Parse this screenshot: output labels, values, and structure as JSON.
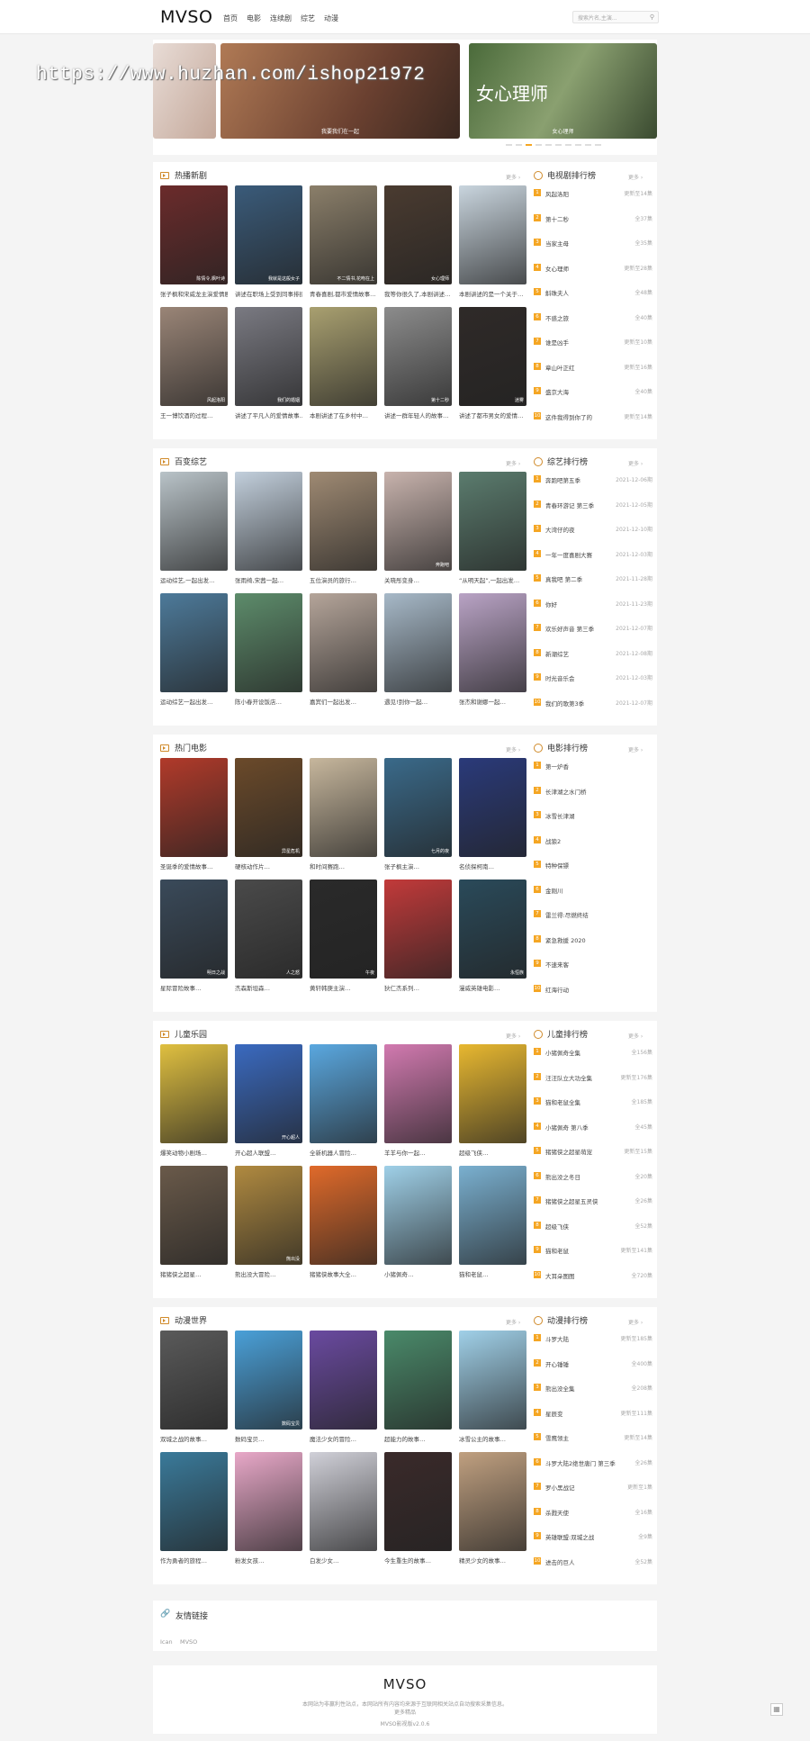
{
  "header": {
    "logo": "MVSO",
    "nav": [
      "首页",
      "电影",
      "连续剧",
      "综艺",
      "动漫"
    ],
    "search_placeholder": "搜索片名,主演..."
  },
  "watermark": "https://www.huzhan.com/ishop21972",
  "slider": {
    "slides": [
      {
        "caption": "",
        "big": "",
        "color": "#d9c8bf"
      },
      {
        "caption": "我要我们在一起",
        "big": "",
        "color": "#8a5a3c"
      },
      {
        "caption": "女心理师",
        "big": "女心理师",
        "color": "#5f7a4a"
      }
    ]
  },
  "sections": [
    {
      "title": "热播新剧",
      "more": "更多 ›",
      "items": [
        {
          "title": "张子枫和宋威龙主演爱情剧…",
          "label": "陈情令,枫叶诗",
          "color": "#6b2b2b"
        },
        {
          "title": "讲述在职场上受到同事排挤…",
          "label": "我就是这般女子",
          "color": "#3a5b7a"
        },
        {
          "title": "青春喜剧,都市爱情故事…",
          "label": "不二情书,花吻在上",
          "color": "#8b7f6a"
        },
        {
          "title": "我等你很久了,本剧讲述…",
          "label": "女心理师",
          "color": "#4a3b30"
        },
        {
          "title": "本剧讲述的是一个关于…",
          "label": "",
          "color": "#c9d5de"
        },
        {
          "title": "王一博饮酒的过程…",
          "label": "风起洛阳",
          "color": "#9a8577"
        },
        {
          "title": "讲述了平凡人的爱情故事…",
          "label": "我们的婚姻",
          "color": "#7a7a82"
        },
        {
          "title": "本剧讲述了在乡村中…",
          "label": "",
          "color": "#a9a070"
        },
        {
          "title": "讲述一群年轻人的故事…",
          "label": "第十二秒",
          "color": "#8c8c8c"
        },
        {
          "title": "讲述了都市男女的爱情…",
          "label": "迷雾",
          "color": "#2f2a28"
        }
      ],
      "rank_title": "电视剧排行榜",
      "rank": [
        {
          "name": "风起洛阳",
          "status": "更新至14集"
        },
        {
          "name": "第十二秒",
          "status": "全37集"
        },
        {
          "name": "当家主母",
          "status": "全35集"
        },
        {
          "name": "女心理师",
          "status": "更新至28集"
        },
        {
          "name": "斛珠夫人",
          "status": "全48集"
        },
        {
          "name": "不惑之旅",
          "status": "全40集"
        },
        {
          "name": "谁是凶手",
          "status": "更新至10集"
        },
        {
          "name": "章山叶正红",
          "status": "更新至16集"
        },
        {
          "name": "盛京大海",
          "status": "全40集"
        },
        {
          "name": "这件我得到你了的",
          "status": "更新至14集"
        }
      ]
    },
    {
      "title": "百变综艺",
      "more": "更多 ›",
      "items": [
        {
          "title": "运动综艺,一起出发…",
          "label": "",
          "color": "#b9c3c8"
        },
        {
          "title": "张雨绮,宋茜一起…",
          "label": "",
          "color": "#c2cfdc"
        },
        {
          "title": "五位演员的旅行…",
          "label": "",
          "color": "#9f8a73"
        },
        {
          "title": "关晓彤变身…",
          "label": "奔跑吧",
          "color": "#c8b3ad"
        },
        {
          "title": "“从明天起”,一起出发…",
          "label": "",
          "color": "#5b7c6e"
        },
        {
          "title": "运动综艺一起出发…",
          "label": "",
          "color": "#4d7a9a"
        },
        {
          "title": "陈小春开设饭店…",
          "label": "",
          "color": "#5d8c6b"
        },
        {
          "title": "嘉宾们一起出发…",
          "label": "",
          "color": "#b5a59a"
        },
        {
          "title": "遇见!到你一起…",
          "label": "",
          "color": "#a7b9c8"
        },
        {
          "title": "张杰和谢娜一起…",
          "label": "",
          "color": "#b9a3c5"
        }
      ],
      "rank_title": "综艺排行榜",
      "rank": [
        {
          "name": "奔跑吧第五季",
          "status": "2021-12-06期"
        },
        {
          "name": "青春环游记 第三季",
          "status": "2021-12-05期"
        },
        {
          "name": "大湾仔的夜",
          "status": "2021-12-10期"
        },
        {
          "name": "一年一度喜剧大赛",
          "status": "2021-12-03期"
        },
        {
          "name": "真我吧 第二季",
          "status": "2021-11-28期"
        },
        {
          "name": "你好",
          "status": "2021-11-23期"
        },
        {
          "name": "欢乐好声音 第三季",
          "status": "2021-12-07期"
        },
        {
          "name": "新潮综艺",
          "status": "2021-12-08期"
        },
        {
          "name": "时光音乐会",
          "status": "2021-12-03期"
        },
        {
          "name": "我们的歌第3季",
          "status": "2021-12-07期"
        }
      ]
    },
    {
      "title": "热门电影",
      "more": "更多 ›",
      "items": [
        {
          "title": "圣诞季的爱情故事…",
          "label": "",
          "color": "#b13a2a"
        },
        {
          "title": "硬核动作片…",
          "label": "异星危机",
          "color": "#6b4a2a"
        },
        {
          "title": "和时间赛跑…",
          "label": "",
          "color": "#c7b79d"
        },
        {
          "title": "张子枫主演…",
          "label": "七月的夜",
          "color": "#3a6a8a"
        },
        {
          "title": "名侦探柯南…",
          "label": "",
          "color": "#2a3a7a"
        },
        {
          "title": "星际冒险故事…",
          "label": "明日之战",
          "color": "#3a4a5a"
        },
        {
          "title": "杰森斯坦森…",
          "label": "人之怒",
          "color": "#4a4a4a"
        },
        {
          "title": "黄轩韩庚主演…",
          "label": "午夜",
          "color": "#2a2a2a"
        },
        {
          "title": "狄仁杰系列…",
          "label": "",
          "color": "#c23a3a"
        },
        {
          "title": "漫威英雄电影…",
          "label": "永恒族",
          "color": "#2a4a5a"
        }
      ],
      "rank_title": "电影排行榜",
      "rank": [
        {
          "name": "第一炉香",
          "status": ""
        },
        {
          "name": "长津湖之水门桥",
          "status": ""
        },
        {
          "name": "冰雪长津湖",
          "status": ""
        },
        {
          "name": "战狼2",
          "status": ""
        },
        {
          "name": "特种保镖",
          "status": ""
        },
        {
          "name": "金刚川",
          "status": ""
        },
        {
          "name": "雷兰得:尽燃终结",
          "status": ""
        },
        {
          "name": "紧急救援 2020",
          "status": ""
        },
        {
          "name": "不速来客",
          "status": ""
        },
        {
          "name": "红海行动",
          "status": ""
        }
      ]
    },
    {
      "title": "儿童乐园",
      "more": "更多 ›",
      "items": [
        {
          "title": "爆笑动物小剧场…",
          "label": "",
          "color": "#e0c040"
        },
        {
          "title": "开心超人联盟…",
          "label": "开心超人",
          "color": "#3a6ac0"
        },
        {
          "title": "全新机器人冒险…",
          "label": "",
          "color": "#5aa8e0"
        },
        {
          "title": "羊羊与你一起…",
          "label": "",
          "color": "#d27ab0"
        },
        {
          "title": "超级飞侠…",
          "label": "",
          "color": "#e8b830"
        },
        {
          "title": "猪猪侠之超星…",
          "label": "",
          "color": "#6a5a4a"
        },
        {
          "title": "熊出没大冒险…",
          "label": "熊出没",
          "color": "#b08a40"
        },
        {
          "title": "猪猪侠故事大全…",
          "label": "",
          "color": "#e06a2a"
        },
        {
          "title": "小猪佩奇…",
          "label": "",
          "color": "#9fd0e8"
        },
        {
          "title": "猫和老鼠…",
          "label": "",
          "color": "#7ab0d0"
        }
      ],
      "rank_title": "儿童排行榜",
      "rank": [
        {
          "name": "小猪佩奇全集",
          "status": "全156集"
        },
        {
          "name": "汪汪队立大功全集",
          "status": "更新至176集"
        },
        {
          "name": "猫和老鼠全集",
          "status": "全185集"
        },
        {
          "name": "小猪佩奇 第八季",
          "status": "全45集"
        },
        {
          "name": "猪猪侠之超星萌宠",
          "status": "更新至15集"
        },
        {
          "name": "熊出没之冬日",
          "status": "全20集"
        },
        {
          "name": "猪猪侠之超星五灵侠",
          "status": "全26集"
        },
        {
          "name": "超级飞侠",
          "status": "全52集"
        },
        {
          "name": "猫和老鼠",
          "status": "更新至141集"
        },
        {
          "name": "大耳朵图图",
          "status": "全720集"
        }
      ]
    },
    {
      "title": "动漫世界",
      "more": "更多 ›",
      "items": [
        {
          "title": "双城之战的故事…",
          "label": "",
          "color": "#5a5a5a"
        },
        {
          "title": "数码宝贝…",
          "label": "数码宝贝",
          "color": "#4aa0d8"
        },
        {
          "title": "魔法少女的冒险…",
          "label": "",
          "color": "#6a4aa0"
        },
        {
          "title": "超能力的故事…",
          "label": "",
          "color": "#4a8a6a"
        },
        {
          "title": "冰雪公主的故事…",
          "label": "",
          "color": "#a0d0e8"
        },
        {
          "title": "作为勇者的旅程…",
          "label": "",
          "color": "#3a7a9a"
        },
        {
          "title": "粉发女孩…",
          "label": "",
          "color": "#e8a8c8"
        },
        {
          "title": "白发少女…",
          "label": "",
          "color": "#d0d0d8"
        },
        {
          "title": "今生重生的故事…",
          "label": "",
          "color": "#3a2a2a"
        },
        {
          "title": "精灵少女的故事…",
          "label": "",
          "color": "#c0a080"
        }
      ],
      "rank_title": "动漫排行榜",
      "rank": [
        {
          "name": "斗罗大陆",
          "status": "更新至185集"
        },
        {
          "name": "开心锤锤",
          "status": "全400集"
        },
        {
          "name": "熊出没全集",
          "status": "全208集"
        },
        {
          "name": "星辰变",
          "status": "更新至111集"
        },
        {
          "name": "雪鹰领主",
          "status": "更新至14集"
        },
        {
          "name": "斗罗大陆2绝世唐门 第三季",
          "status": "全26集"
        },
        {
          "name": "罗小黑战记",
          "status": "更新至1集"
        },
        {
          "name": "杀戮天使",
          "status": "全16集"
        },
        {
          "name": "英雄联盟:双城之战",
          "status": "全9集"
        },
        {
          "name": "进击的巨人",
          "status": "全52集"
        }
      ]
    }
  ],
  "friend_links": {
    "title": "友情链接",
    "items": [
      "Ican",
      "MVSO"
    ]
  },
  "footer": {
    "logo": "MVSO",
    "disclaimer": "本网站为非赢利性站点，本网站所有内容均来源于互联网相关站点自动搜索采集信息。",
    "more": "更多精品",
    "version": "MVSO影视版v2.0.6"
  }
}
